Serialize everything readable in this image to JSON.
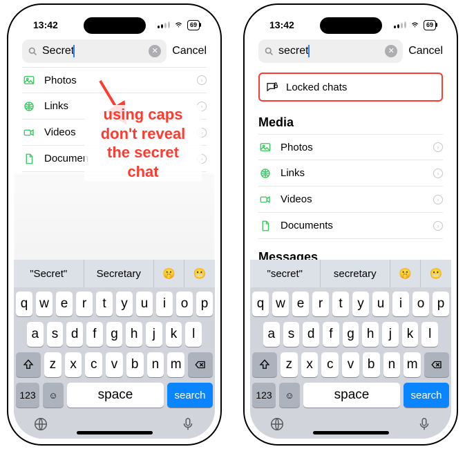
{
  "status": {
    "time": "13:42",
    "battery": "69"
  },
  "search": {
    "cancel": "Cancel",
    "left_query": "Secret",
    "right_query": "secret"
  },
  "annotation": {
    "lines": [
      "using caps",
      "don't reveal",
      "the secret",
      "chat"
    ]
  },
  "locked_label": "Locked chats",
  "sections": {
    "media": "Media",
    "messages": "Messages"
  },
  "media_rows": [
    {
      "icon": "photo",
      "label": "Photos"
    },
    {
      "icon": "link",
      "label": "Links"
    },
    {
      "icon": "video",
      "label": "Videos"
    },
    {
      "icon": "document",
      "label": "Documents"
    }
  ],
  "left_rows": [
    {
      "icon": "photo",
      "label": "Photos"
    },
    {
      "icon": "link",
      "label": "Links"
    },
    {
      "icon": "video",
      "label": "Videos"
    },
    {
      "icon": "document",
      "label": "Documen"
    }
  ],
  "suggestions": {
    "left": [
      "\"Secret\"",
      "Secretary",
      "🤫",
      "😬"
    ],
    "right": [
      "\"secret\"",
      "secretary",
      "🤫",
      "😬"
    ]
  },
  "keyboard": {
    "row1": [
      "q",
      "w",
      "e",
      "r",
      "t",
      "y",
      "u",
      "i",
      "o",
      "p"
    ],
    "row2": [
      "a",
      "s",
      "d",
      "f",
      "g",
      "h",
      "j",
      "k",
      "l"
    ],
    "row3": [
      "z",
      "x",
      "c",
      "v",
      "b",
      "n",
      "m"
    ],
    "space": "space",
    "search": "search",
    "numkey": "123"
  }
}
